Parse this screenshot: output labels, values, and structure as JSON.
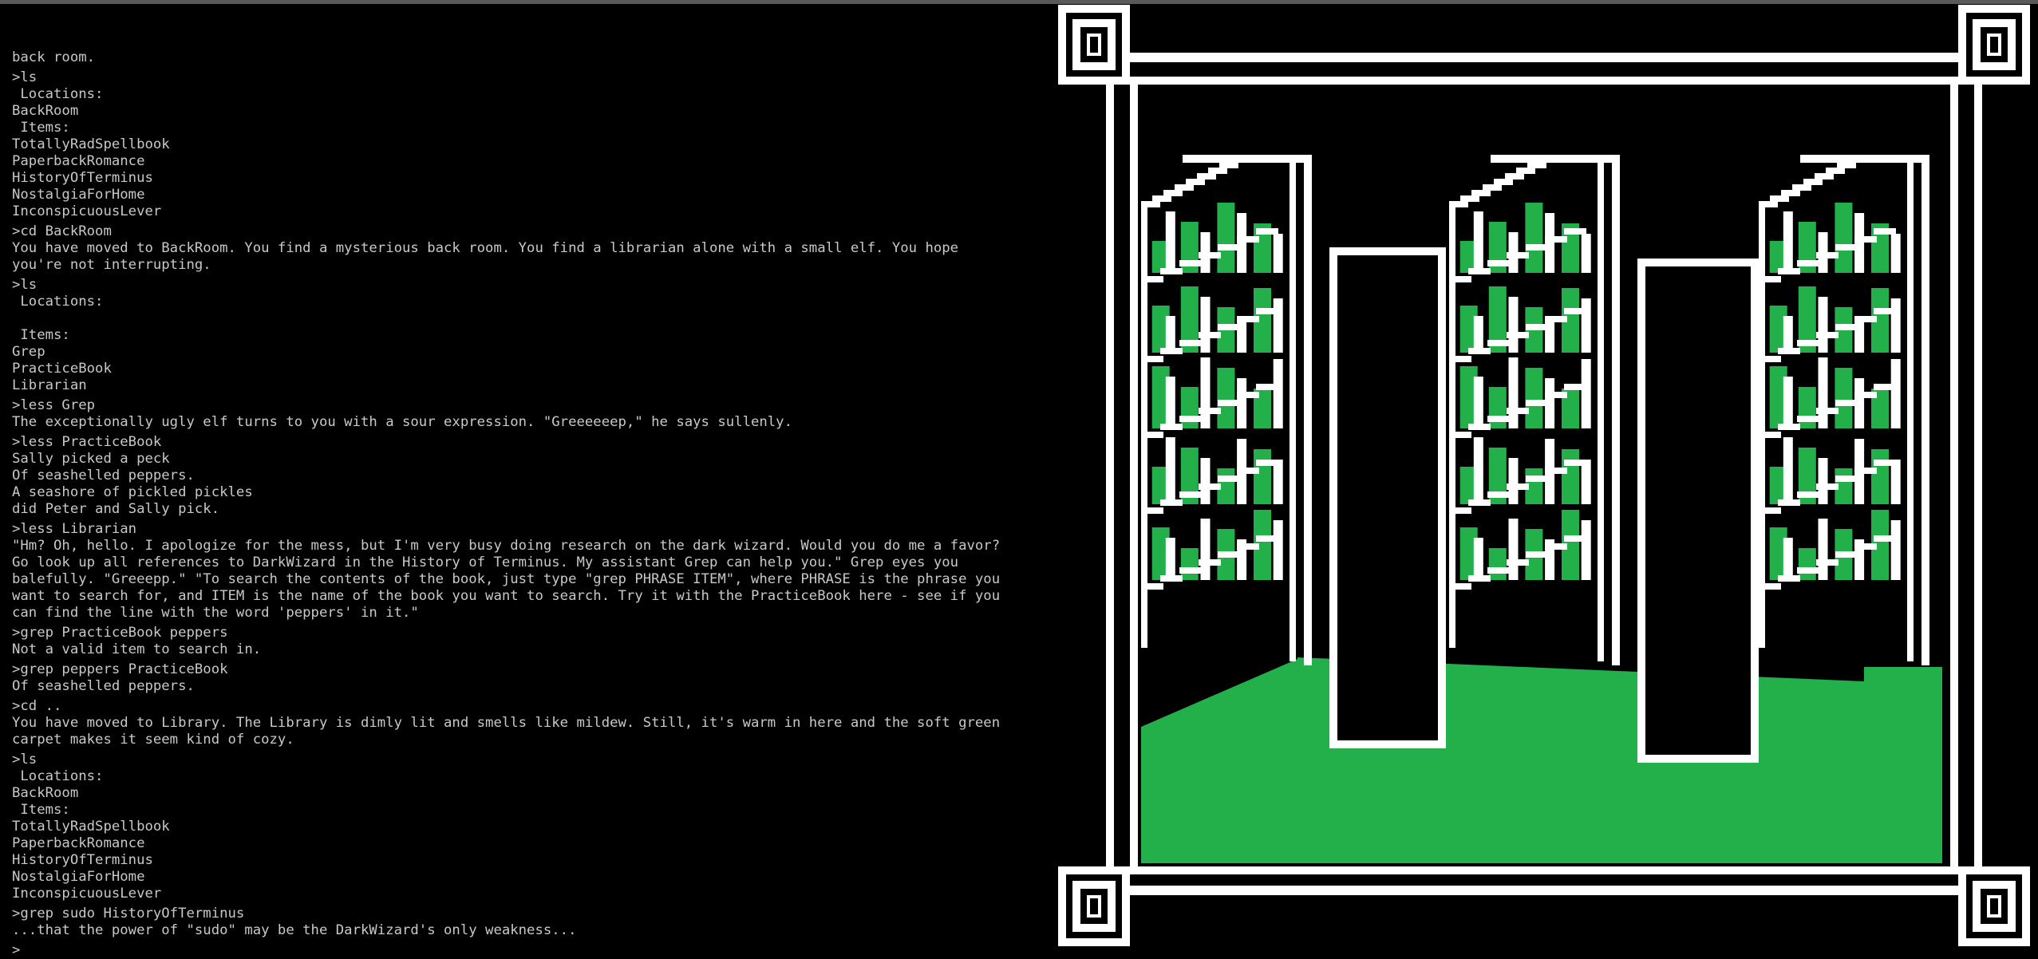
{
  "terminal": {
    "lines": [
      {
        "t": "back room.",
        "k": "out"
      },
      {
        "t": ">ls",
        "k": "cmd"
      },
      {
        "t": " Locations:",
        "k": "out"
      },
      {
        "t": "BackRoom",
        "k": "out"
      },
      {
        "t": " Items:",
        "k": "out"
      },
      {
        "t": "TotallyRadSpellbook",
        "k": "out"
      },
      {
        "t": "PaperbackRomance",
        "k": "out"
      },
      {
        "t": "HistoryOfTerminus",
        "k": "out"
      },
      {
        "t": "NostalgiaForHome",
        "k": "out"
      },
      {
        "t": "InconspicuousLever",
        "k": "out"
      },
      {
        "t": ">cd BackRoom",
        "k": "cmd"
      },
      {
        "t": "You have moved to BackRoom. You find a mysterious back room. You find a librarian alone with a small elf. You hope",
        "k": "out"
      },
      {
        "t": "you're not interrupting.",
        "k": "out"
      },
      {
        "t": ">ls",
        "k": "cmd"
      },
      {
        "t": " Locations:",
        "k": "out"
      },
      {
        "t": "",
        "k": "blank"
      },
      {
        "t": " Items:",
        "k": "out"
      },
      {
        "t": "Grep",
        "k": "out"
      },
      {
        "t": "PracticeBook",
        "k": "out"
      },
      {
        "t": "Librarian",
        "k": "out"
      },
      {
        "t": ">less Grep",
        "k": "cmd"
      },
      {
        "t": "The exceptionally ugly elf turns to you with a sour expression. \"Greeeeeep,\" he says sullenly.",
        "k": "out"
      },
      {
        "t": ">less PracticeBook",
        "k": "cmd"
      },
      {
        "t": "Sally picked a peck",
        "k": "out"
      },
      {
        "t": "Of seashelled peppers.",
        "k": "out"
      },
      {
        "t": "A seashore of pickled pickles",
        "k": "out"
      },
      {
        "t": "did Peter and Sally pick.",
        "k": "out"
      },
      {
        "t": ">less Librarian",
        "k": "cmd"
      },
      {
        "t": "\"Hm? Oh, hello. I apologize for the mess, but I'm very busy doing research on the dark wizard. Would you do me a favor?",
        "k": "out"
      },
      {
        "t": "Go look up all references to DarkWizard in the History of Terminus. My assistant Grep can help you.\" Grep eyes you",
        "k": "out"
      },
      {
        "t": "balefully. \"Greeepp.\" \"To search the contents of the book, just type \"grep PHRASE ITEM\", where PHRASE is the phrase you",
        "k": "out"
      },
      {
        "t": "want to search for, and ITEM is the name of the book you want to search. Try it with the PracticeBook here - see if you",
        "k": "out"
      },
      {
        "t": "can find the line with the word 'peppers' in it.\"",
        "k": "out"
      },
      {
        "t": ">grep PracticeBook peppers",
        "k": "cmd"
      },
      {
        "t": "Not a valid item to search in.",
        "k": "out"
      },
      {
        "t": ">grep peppers PracticeBook",
        "k": "cmd"
      },
      {
        "t": "Of seashelled peppers.",
        "k": "out"
      },
      {
        "t": ">cd ..",
        "k": "cmd"
      },
      {
        "t": "You have moved to Library. The Library is dimly lit and smells like mildew. Still, it's warm in here and the soft green",
        "k": "out"
      },
      {
        "t": "carpet makes it seem kind of cozy.",
        "k": "out"
      },
      {
        "t": ">ls",
        "k": "cmd"
      },
      {
        "t": " Locations:",
        "k": "out"
      },
      {
        "t": "BackRoom",
        "k": "out"
      },
      {
        "t": " Items:",
        "k": "out"
      },
      {
        "t": "TotallyRadSpellbook",
        "k": "out"
      },
      {
        "t": "PaperbackRomance",
        "k": "out"
      },
      {
        "t": "HistoryOfTerminus",
        "k": "out"
      },
      {
        "t": "NostalgiaForHome",
        "k": "out"
      },
      {
        "t": "InconspicuousLever",
        "k": "out"
      },
      {
        "t": ">grep sudo HistoryOfTerminus",
        "k": "cmd"
      },
      {
        "t": "...that the power of \"sudo\" may be the DarkWizard's only weakness...",
        "k": "out"
      },
      {
        "t": ">",
        "k": "cmd"
      }
    ]
  },
  "scene": {
    "location": "Library",
    "icons": [
      "bookshelf-icon",
      "bookshelf-icon",
      "bookshelf-icon",
      "greek-key-frame-icon"
    ],
    "colors": {
      "background": "#000000",
      "terminal_text": "#c8c8c8",
      "art_line": "#ffffff",
      "art_green": "#23b04b"
    }
  }
}
